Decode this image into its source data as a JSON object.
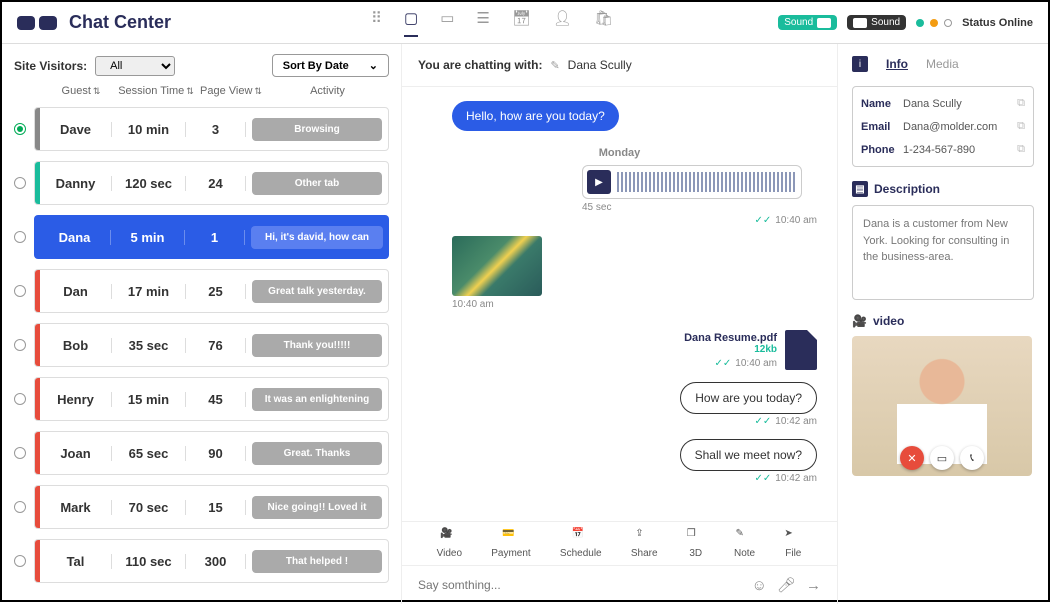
{
  "app_title": "Chat Center",
  "top_right": {
    "sound1": "Sound",
    "sound2": "Sound",
    "status": "Status Online"
  },
  "left": {
    "visitors_label": "Site Visitors:",
    "visitors_filter": "All",
    "sort_label": "Sort By Date",
    "headers": {
      "guest": "Guest",
      "session": "Session Time",
      "pageview": "Page View",
      "activity": "Activity"
    },
    "rows": [
      {
        "name": "Dave",
        "session": "10 min",
        "pv": "3",
        "activity": "Browsing",
        "bar": "gray",
        "selected": true,
        "active": false
      },
      {
        "name": "Danny",
        "session": "120 sec",
        "pv": "24",
        "activity": "Other tab",
        "bar": "teal",
        "selected": false,
        "active": false
      },
      {
        "name": "Dana",
        "session": "5 min",
        "pv": "1",
        "activity": "Hi, it's david, how can",
        "bar": "",
        "selected": false,
        "active": true
      },
      {
        "name": "Dan",
        "session": "17 min",
        "pv": "25",
        "activity": "Great talk yesterday.",
        "bar": "red",
        "selected": false,
        "active": false
      },
      {
        "name": "Bob",
        "session": "35 sec",
        "pv": "76",
        "activity": "Thank you!!!!!",
        "bar": "red",
        "selected": false,
        "active": false
      },
      {
        "name": "Henry",
        "session": "15 min",
        "pv": "45",
        "activity": "It was an enlightening",
        "bar": "red",
        "selected": false,
        "active": false
      },
      {
        "name": "Joan",
        "session": "65 sec",
        "pv": "90",
        "activity": "Great. Thanks",
        "bar": "red",
        "selected": false,
        "active": false
      },
      {
        "name": "Mark",
        "session": "70 sec",
        "pv": "15",
        "activity": "Nice going!! Loved it",
        "bar": "red",
        "selected": false,
        "active": false
      },
      {
        "name": "Tal",
        "session": "110 sec",
        "pv": "300",
        "activity": "That helped !",
        "bar": "red",
        "selected": false,
        "active": false
      }
    ]
  },
  "chat": {
    "header_label": "You are chatting with:",
    "contact_name": "Dana Scully",
    "out1": "Hello, how are you today?",
    "day": "Monday",
    "audio_len": "45 sec",
    "audio_time": "10:40 am",
    "img_time": "10:40 am",
    "file_name": "Dana Resume.pdf",
    "file_size": "12kb",
    "file_time": "10:40 am",
    "in1": "How are you today?",
    "in1_time": "10:42 am",
    "in2": "Shall we meet now?",
    "in2_time": "10:42 am",
    "tools": {
      "video": "Video",
      "payment": "Payment",
      "schedule": "Schedule",
      "share": "Share",
      "td": "3D",
      "note": "Note",
      "file": "File"
    },
    "input_placeholder": "Say somthing..."
  },
  "right": {
    "tabs": {
      "info": "Info",
      "media": "Media"
    },
    "contact": {
      "name_label": "Name",
      "name": "Dana Scully",
      "email_label": "Email",
      "email": "Dana@molder.com",
      "phone_label": "Phone",
      "phone": "1-234-567-890"
    },
    "desc_label": "Description",
    "desc": "Dana is a customer from New York. Looking for consulting in the business-area.",
    "video_label": "video"
  }
}
